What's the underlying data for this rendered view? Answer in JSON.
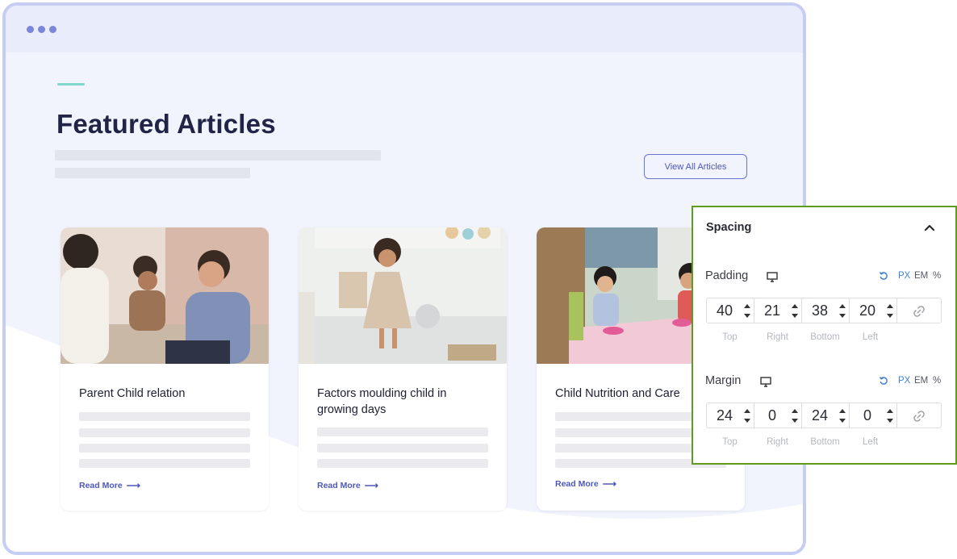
{
  "section": {
    "heading": "Featured Articles",
    "view_all_label": "View All Articles"
  },
  "cards": [
    {
      "title": "Parent Child relation",
      "read_more": "Read More",
      "image": "parent-child-photo"
    },
    {
      "title": "Factors moulding child in growing days",
      "read_more": "Read More",
      "image": "child-playing-photo"
    },
    {
      "title": "Child Nutrition and Care",
      "read_more": "Read More",
      "image": "children-eating-photo"
    }
  ],
  "spacing_panel": {
    "title": "Spacing",
    "units": [
      "PX",
      "EM",
      "%"
    ],
    "active_unit": "PX",
    "padding": {
      "label": "Padding",
      "values": [
        "40",
        "21",
        "38",
        "20"
      ],
      "sides": [
        "Top",
        "Right",
        "Bottom",
        "Left"
      ]
    },
    "margin": {
      "label": "Margin",
      "values": [
        "24",
        "0",
        "24",
        "0"
      ],
      "sides": [
        "Top",
        "Right",
        "Bottom",
        "Left"
      ]
    }
  },
  "colors": {
    "accent": "#5f9c1e",
    "brand": "#4d57b8",
    "heading": "#212446",
    "active_unit": "#3f7fd6"
  }
}
